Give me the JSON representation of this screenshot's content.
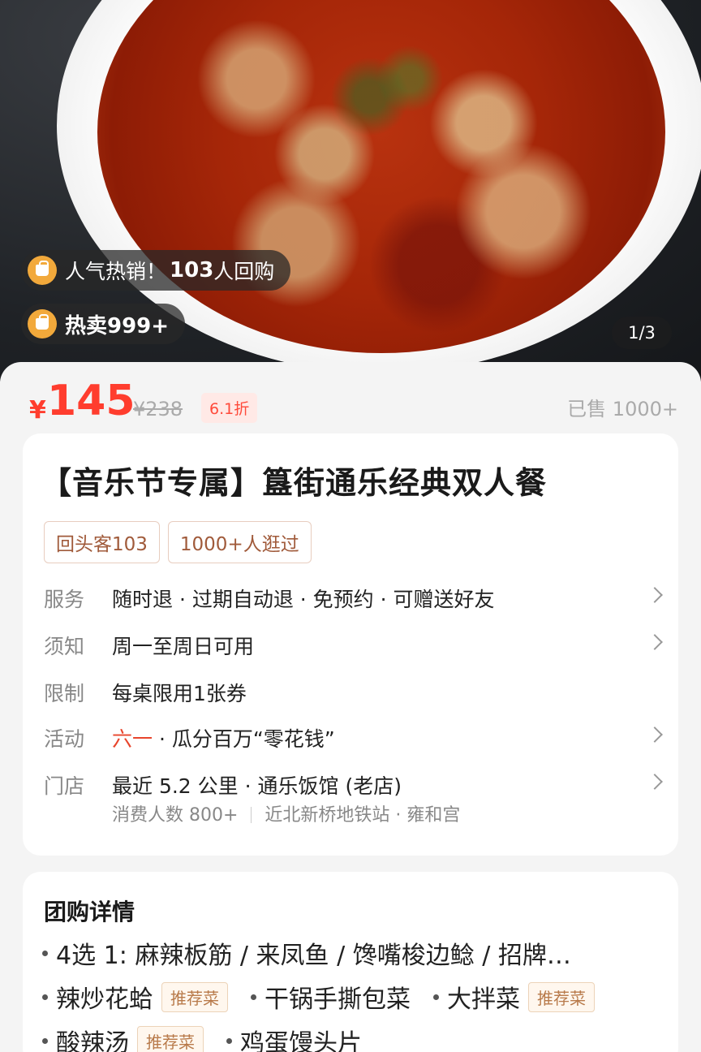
{
  "hero": {
    "badge_popular_prefix": "人气热销！",
    "badge_popular_count": "103",
    "badge_popular_suffix": "人回购",
    "badge_hot": "热卖999+",
    "pager": "1/3"
  },
  "price": {
    "currency": "¥",
    "current": "145",
    "original": "¥238",
    "discount": "6.1折",
    "sold": "已售 1000+"
  },
  "deal": {
    "title": "【音乐节专属】簋街通乐经典双人餐",
    "tags": [
      "回头客103",
      "1000+人逛过"
    ],
    "rows": {
      "service": {
        "key": "服务",
        "value": "随时退 · 过期自动退 · 免预约 · 可赠送好友"
      },
      "notice": {
        "key": "须知",
        "value": "周一至周日可用"
      },
      "limit": {
        "key": "限制",
        "value": "每桌限用1张券"
      },
      "activity": {
        "key": "活动",
        "highlight": "六一",
        "value": " · 瓜分百万“零花钱”"
      },
      "store": {
        "key": "门店",
        "value": "最近 5.2 公里 · 通乐饭馆 (老店)"
      }
    },
    "store_sub_left": "消费人数 800+",
    "store_sub_right": "近北新桥地铁站 · 雍和宫"
  },
  "details": {
    "title": "团购详情",
    "line1": "4选 1:  麻辣板筋 / 来凤鱼 / 馋嘴梭边鲶 / 招牌…",
    "item_a": "辣炒花蛤",
    "item_b": "干锅手撕包菜",
    "item_c": "大拌菜",
    "item_d": "酸辣汤",
    "item_e": "鸡蛋馒头片",
    "rec_label": "推荐菜"
  },
  "colors": {
    "accent": "#ff3d2e",
    "badge_bag": "#f2a93b"
  }
}
